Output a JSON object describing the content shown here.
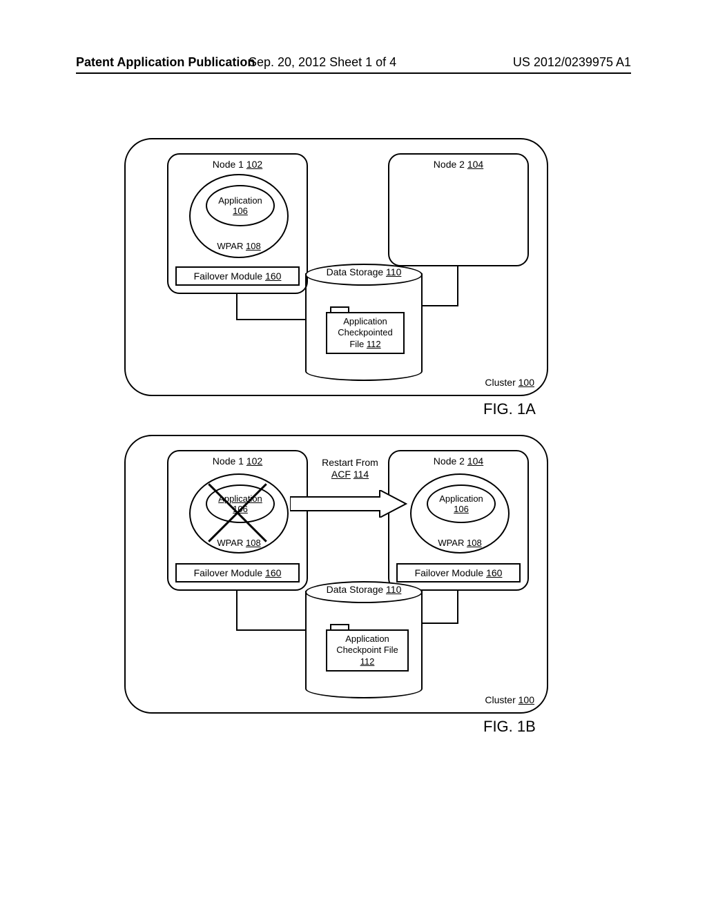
{
  "header": {
    "left": "Patent Application Publication",
    "center": "Sep. 20, 2012  Sheet 1 of 4",
    "right": "US 2012/0239975 A1"
  },
  "figA": {
    "cluster_label": "Cluster",
    "cluster_ref": "100",
    "node1_label": "Node 1",
    "node1_ref": "102",
    "node2_label": "Node 2",
    "node2_ref": "104",
    "app_label": "Application",
    "app_ref": "106",
    "wpar_label": "WPAR",
    "wpar_ref": "108",
    "failover_label": "Failover Module",
    "failover_ref": "160",
    "datastore_label": "Data Storage",
    "datastore_ref": "110",
    "acf_line1": "Application",
    "acf_line2": "Checkpointed",
    "acf_line3": "File",
    "acf_ref": "112",
    "caption": "FIG. 1A"
  },
  "figB": {
    "cluster_label": "Cluster",
    "cluster_ref": "100",
    "node1_label": "Node 1",
    "node1_ref": "102",
    "node2_label": "Node 2",
    "node2_ref": "104",
    "app_label": "Application",
    "app_ref": "106",
    "wpar_label": "WPAR",
    "wpar_ref": "108",
    "failover_label": "Failover Module",
    "failover_ref": "160",
    "datastore_label": "Data Storage",
    "datastore_ref": "110",
    "acf_line1": "Application",
    "acf_line2": "Checkpoint File",
    "acf_ref": "112",
    "restart_line1": "Restart From",
    "restart_line2": "ACF",
    "restart_ref": "114",
    "caption": "FIG. 1B"
  }
}
